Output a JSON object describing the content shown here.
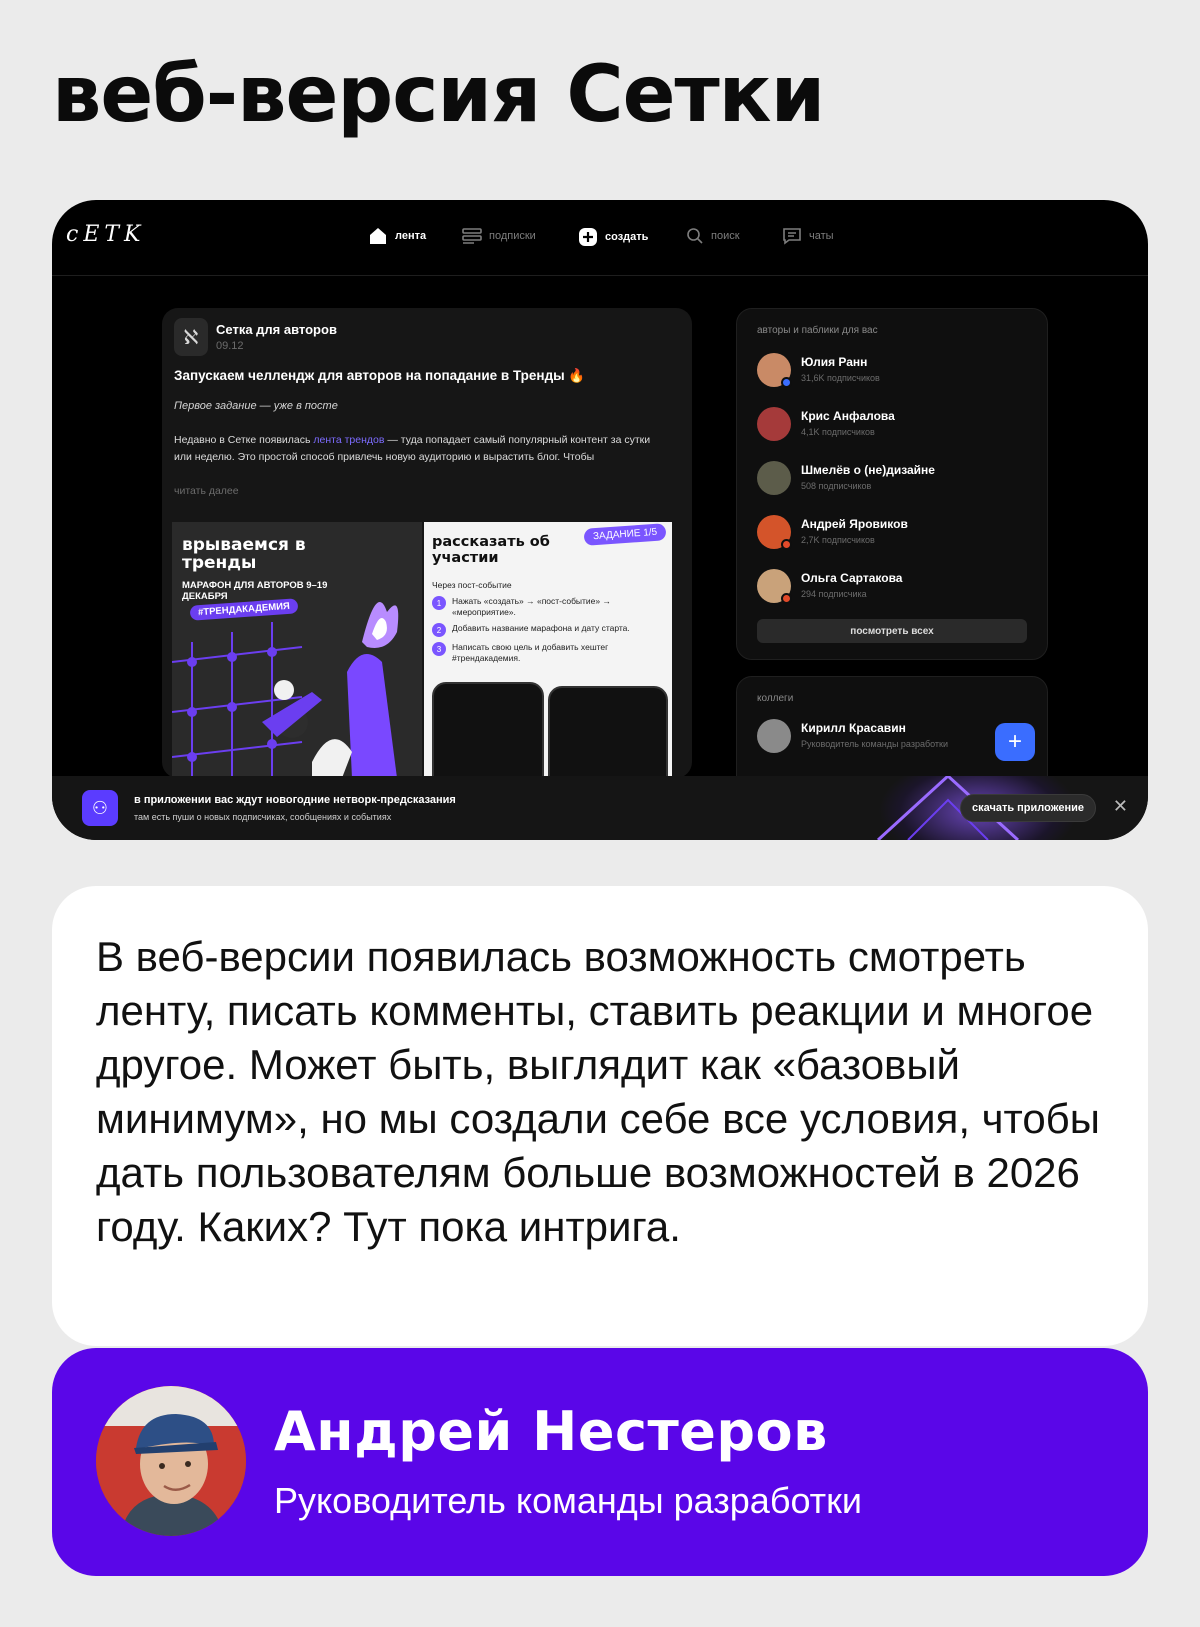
{
  "page": {
    "title": "веб-версия Сетки"
  },
  "app": {
    "logo": "cETK",
    "nav": [
      {
        "label": "лента",
        "icon": "home-icon",
        "active": true
      },
      {
        "label": "подписки",
        "icon": "subscriptions-icon",
        "active": false
      },
      {
        "label": "создать",
        "icon": "plus-square-icon",
        "active": true
      },
      {
        "label": "поиск",
        "icon": "search-icon",
        "active": false
      },
      {
        "label": "чаты",
        "icon": "chat-icon",
        "active": false
      }
    ]
  },
  "post": {
    "author": "Сетка для авторов",
    "date": "09.12",
    "title": "Запускаем челлендж для авторов на попадание в Тренды 🔥",
    "subtitle": "Первое задание — уже в посте",
    "body_before_link": "Недавно в Сетке появилась ",
    "body_link": "лента трендов",
    "body_after_link": " — туда попадает самый популярный контент за сутки или неделю. Это простой способ привлечь новую аудиторию и вырастить блог. Чтобы",
    "read_more": "читать далее",
    "promo_left": {
      "title": "врываемся в тренды",
      "subtitle": "МАРАФОН ДЛЯ АВТОРОВ 9–19 ДЕКАБРЯ",
      "tag": "#ТРЕНДАКАДЕМИЯ"
    },
    "promo_right": {
      "badge": "ЗАДАНИЕ 1/5",
      "title": "рассказать об участии",
      "via": "Через пост-событие",
      "steps": [
        "Нажать «создать» → «пост-событие» → «мероприятие».",
        "Добавить название марафона и дату старта.",
        "Написать свою цель и добавить хештег #трендакадемия."
      ]
    }
  },
  "sidebar": {
    "header": "авторы и паблики для вас",
    "people": [
      {
        "name": "Юлия Ранн",
        "subs": "31,6K подписчиков",
        "color": "#c98a66",
        "dot": "#3a6dff"
      },
      {
        "name": "Крис Анфалова",
        "subs": "4,1K подписчиков",
        "color": "#a53a3a",
        "dot": ""
      },
      {
        "name": "Шмелёв о (не)дизайне",
        "subs": "508 подписчиков",
        "color": "#5c5c4a",
        "dot": ""
      },
      {
        "name": "Андрей Яровиков",
        "subs": "2,7K подписчиков",
        "color": "#d4542a",
        "dot": "#e24a2a"
      },
      {
        "name": "Ольга Сартакова",
        "subs": "294 подписчика",
        "color": "#c9a27a",
        "dot": "#e24a2a"
      }
    ],
    "see_all": "посмотреть всех",
    "colleagues_header": "коллеги",
    "colleague": {
      "name": "Кирилл Красавин",
      "role": "Руководитель команды разработки",
      "color": "#8a8a8a"
    }
  },
  "banner": {
    "line1": "в приложении вас ждут новогодние нетворк-предсказания",
    "line2": "там есть пуши о новых подписчиках, сообщениях и событиях",
    "button": "скачать приложение",
    "close": "✕"
  },
  "text_card": {
    "paragraph": "В веб-версии появилась возможность смотреть ленту, писать комменты, ставить реакции и многое другое. Может быть, выглядит как «базовый минимум», но мы создали себе все условия, чтобы дать пользователям больше возможностей в 2026 году. Каких? Тут пока интрига."
  },
  "author": {
    "name": "Андрей Нестеров",
    "role": "Руководитель команды разработки"
  },
  "colors": {
    "accent_purple": "#5a06e8",
    "link": "#7d6cff",
    "page_bg": "#ebebeb"
  }
}
